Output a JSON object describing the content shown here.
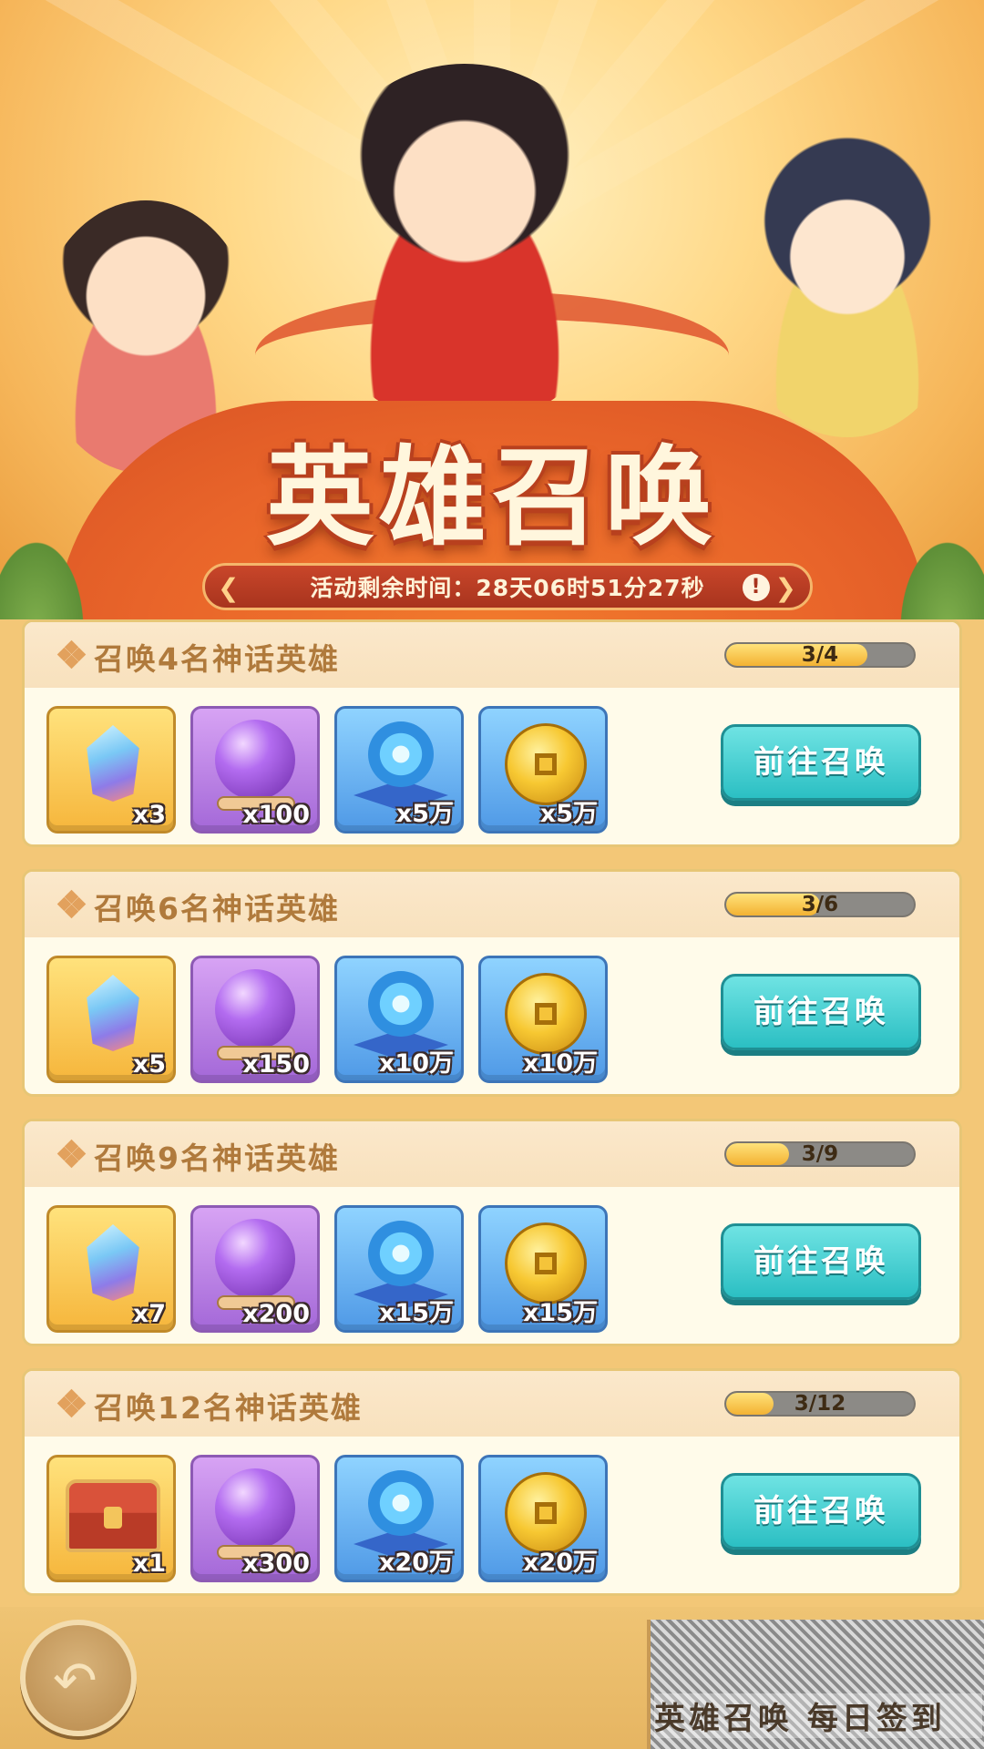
{
  "banner": {
    "title": "英雄召唤",
    "timer_text": "活动剩余时间：28天06时51分27秒",
    "info_icon": "!"
  },
  "tasks": [
    {
      "title": "召唤4名神话英雄",
      "progress_text": "3/4",
      "progress_value": 0.75,
      "rewards": [
        {
          "icon": "crystal-icon",
          "qty": "x3"
        },
        {
          "icon": "orb-icon",
          "qty": "x100"
        },
        {
          "icon": "swirl-orb-icon",
          "qty": "x5万"
        },
        {
          "icon": "gold-coin-icon",
          "qty": "x5万"
        }
      ],
      "button": "前往召唤"
    },
    {
      "title": "召唤6名神话英雄",
      "progress_text": "3/6",
      "progress_value": 0.5,
      "rewards": [
        {
          "icon": "crystal-icon",
          "qty": "x5"
        },
        {
          "icon": "orb-icon",
          "qty": "x150"
        },
        {
          "icon": "swirl-orb-icon",
          "qty": "x10万"
        },
        {
          "icon": "gold-coin-icon",
          "qty": "x10万"
        }
      ],
      "button": "前往召唤"
    },
    {
      "title": "召唤9名神话英雄",
      "progress_text": "3/9",
      "progress_value": 0.333,
      "rewards": [
        {
          "icon": "crystal-icon",
          "qty": "x7"
        },
        {
          "icon": "orb-icon",
          "qty": "x200"
        },
        {
          "icon": "swirl-orb-icon",
          "qty": "x15万"
        },
        {
          "icon": "gold-coin-icon",
          "qty": "x15万"
        }
      ],
      "button": "前往召唤"
    },
    {
      "title": "召唤12名神话英雄",
      "progress_text": "3/12",
      "progress_value": 0.25,
      "rewards": [
        {
          "icon": "treasure-chest-icon",
          "qty": "x1"
        },
        {
          "icon": "orb-icon",
          "qty": "x300"
        },
        {
          "icon": "swirl-orb-icon",
          "qty": "x20万"
        },
        {
          "icon": "gold-coin-icon",
          "qty": "x20万"
        }
      ],
      "button": "前往召唤"
    }
  ],
  "bottom": {
    "back_icon": "back-arrow-icon",
    "ad_text": "英雄召唤 每日签到"
  },
  "colors": {
    "accent_teal": "#2bbfc3",
    "title_brown": "#b07a3c",
    "banner_orange": "#e9652a"
  }
}
